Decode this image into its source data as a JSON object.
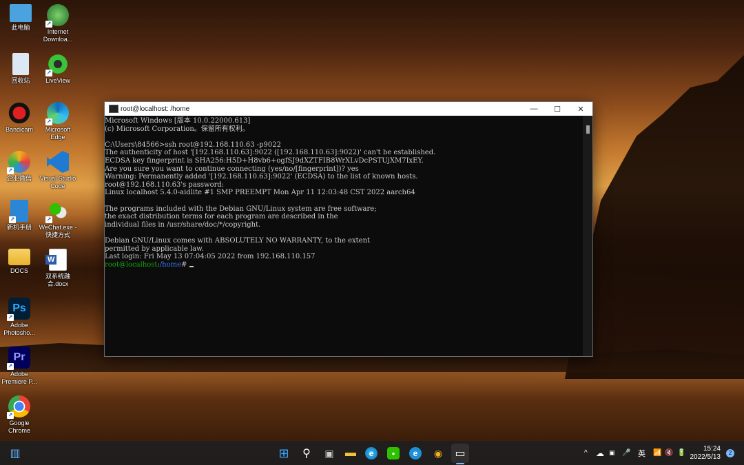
{
  "desktop": {
    "icons": [
      {
        "label": "此电脑",
        "icon": "computer-icon",
        "color": "#4aa3df"
      },
      {
        "label": "Internet Downloa...",
        "icon": "idm-icon",
        "color": "#2e8b3a"
      },
      {
        "label": "回收站",
        "icon": "recycle-bin-icon",
        "color": "#cfe3f5"
      },
      {
        "label": "LiveView",
        "icon": "liveview-icon",
        "color": "#3ac23a"
      },
      {
        "label": "Bandicam",
        "icon": "bandicam-icon",
        "color": "#d42020"
      },
      {
        "label": "Microsoft Edge",
        "icon": "edge-icon",
        "color": "#1e90c8"
      },
      {
        "label": "企业微信",
        "icon": "wecom-icon",
        "color": "#2b7bd6"
      },
      {
        "label": "Visual Studio Code",
        "icon": "vscode-icon",
        "color": "#1f7ad1"
      },
      {
        "label": "新机手册",
        "icon": "manual-icon",
        "color": "#2b86d6"
      },
      {
        "label": "WeChat.exe - 快捷方式",
        "icon": "wechat-icon",
        "color": "#2dc100"
      },
      {
        "label": "DOCS",
        "icon": "folder-icon",
        "color": "#f2c23a"
      },
      {
        "label": "双系统融合.docx",
        "icon": "word-icon",
        "color": "#2b5ea8"
      },
      {
        "label": "Adobe Photosho...",
        "icon": "photoshop-icon",
        "color": "#001e36"
      },
      {
        "label": "Adobe Premiere P...",
        "icon": "premiere-icon",
        "color": "#00005b"
      },
      {
        "label": "Google Chrome",
        "icon": "chrome-icon",
        "color": "#e33b2e"
      }
    ],
    "glyphs": {
      "ps": "Ps",
      "pr": "Pr",
      "word": "W",
      "arrow": "↗"
    }
  },
  "window": {
    "title": "root@localhost: /home",
    "title_icon": "terminal-icon",
    "minimize": "—",
    "maximize": "☐",
    "close": "✕",
    "lines": [
      "Microsoft Windows [版本 10.0.22000.613]",
      "(c) Microsoft Corporation。保留所有权利。",
      "",
      "C:\\Users\\84566>ssh root@192.168.110.63 -p9022",
      "The authenticity of host '[192.168.110.63]:9022 ([192.168.110.63]:9022)' can't be established.",
      "ECDSA key fingerprint is SHA256:H5D+H8vb6+ogfSJ9dXZTFIB8WrXLvDcPSTUjXM7IxEY.",
      "Are you sure you want to continue connecting (yes/no/[fingerprint])? yes",
      "Warning: Permanently added '[192.168.110.63]:9022' (ECDSA) to the list of known hosts.",
      "root@192.168.110.63's password:",
      "Linux localhost 5.4.0-aidlite #1 SMP PREEMPT Mon Apr 11 12:03:48 CST 2022 aarch64",
      "",
      "The programs included with the Debian GNU/Linux system are free software;",
      "the exact distribution terms for each program are described in the",
      "individual files in /usr/share/doc/*/copyright.",
      "",
      "Debian GNU/Linux comes with ABSOLUTELY NO WARRANTY, to the extent",
      "permitted by applicable law.",
      "Last login: Fri May 13 07:04:05 2022 from 192.168.110.157"
    ],
    "prompt_user": "root@localhost",
    "prompt_sep": ":",
    "prompt_path": "/home",
    "prompt_char": "# "
  },
  "taskbar": {
    "items": [
      {
        "icon": "widgets-icon",
        "glyph": "▥"
      },
      {
        "icon": "start-icon",
        "glyph": "⊞"
      },
      {
        "icon": "search-icon",
        "glyph": "⚲"
      },
      {
        "icon": "task-view-icon",
        "glyph": "▣"
      },
      {
        "icon": "file-explorer-icon",
        "glyph": "▬"
      },
      {
        "icon": "edge-icon",
        "glyph": "e"
      },
      {
        "icon": "wechat-icon",
        "glyph": "●"
      },
      {
        "icon": "browser-icon",
        "glyph": "e"
      },
      {
        "icon": "wecom-icon",
        "glyph": "◉"
      },
      {
        "icon": "terminal-icon",
        "glyph": "▭"
      }
    ],
    "tray": {
      "chevron": "^",
      "cloud": "☁",
      "mic": "🎤",
      "ime": "英",
      "wifi": "📶",
      "volume": "🔇",
      "battery": "🔋",
      "time": "15:24",
      "date": "2022/5/13",
      "notifications": "2"
    }
  }
}
